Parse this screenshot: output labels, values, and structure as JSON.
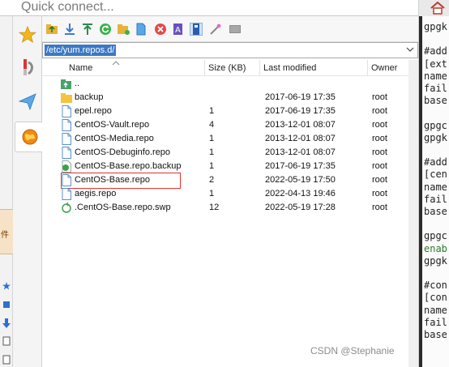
{
  "quick_connect": {
    "placeholder": "Quick connect..."
  },
  "left_strip": {
    "label": "件"
  },
  "path": {
    "value": "/etc/yum.repos.d/"
  },
  "columns": {
    "name": "Name",
    "size": "Size (KB)",
    "modified": "Last modified",
    "owner": "Owner"
  },
  "files": [
    {
      "icon": "parent-folder-icon",
      "name": "..",
      "size": "",
      "date": "",
      "owner": ""
    },
    {
      "icon": "folder-icon",
      "name": "backup",
      "size": "",
      "date": "2017-06-19 17:35",
      "owner": "root"
    },
    {
      "icon": "file-icon",
      "name": "epel.repo",
      "size": "1",
      "date": "2017-06-19 17:35",
      "owner": "root"
    },
    {
      "icon": "file-icon",
      "name": "CentOS-Vault.repo",
      "size": "4",
      "date": "2013-12-01 08:07",
      "owner": "root"
    },
    {
      "icon": "file-icon",
      "name": "CentOS-Media.repo",
      "size": "1",
      "date": "2013-12-01 08:07",
      "owner": "root"
    },
    {
      "icon": "file-icon",
      "name": "CentOS-Debuginfo.repo",
      "size": "1",
      "date": "2013-12-01 08:07",
      "owner": "root"
    },
    {
      "icon": "recycle-file-icon",
      "name": "CentOS-Base.repo.backup",
      "size": "1",
      "date": "2017-06-19 17:35",
      "owner": "root"
    },
    {
      "icon": "file-icon",
      "name": "CentOS-Base.repo",
      "size": "2",
      "date": "2022-05-19 17:50",
      "owner": "root"
    },
    {
      "icon": "file-icon",
      "name": "aegis.repo",
      "size": "1",
      "date": "2022-04-13 19:46",
      "owner": "root"
    },
    {
      "icon": "swap-file-icon",
      "name": ".CentOS-Base.repo.swp",
      "size": "12",
      "date": "2022-05-19 17:28",
      "owner": "root"
    }
  ],
  "terminal_lines": [
    {
      "text": "gpgk",
      "color": "#222222"
    },
    {
      "text": "",
      "color": "#222222"
    },
    {
      "text": "#add",
      "color": "#222222"
    },
    {
      "text": "[ext",
      "color": "#222222"
    },
    {
      "text": "name",
      "color": "#222222"
    },
    {
      "text": "fail",
      "color": "#222222"
    },
    {
      "text": "base",
      "color": "#222222"
    },
    {
      "text": "",
      "color": "#222222"
    },
    {
      "text": "gpgc",
      "color": "#222222"
    },
    {
      "text": "gpgk",
      "color": "#222222"
    },
    {
      "text": "",
      "color": "#222222"
    },
    {
      "text": "#add",
      "color": "#222222"
    },
    {
      "text": "[cen",
      "color": "#222222"
    },
    {
      "text": "name",
      "color": "#222222"
    },
    {
      "text": "fail",
      "color": "#222222"
    },
    {
      "text": "base",
      "color": "#222222"
    },
    {
      "text": "",
      "color": "#222222"
    },
    {
      "text": "gpgc",
      "color": "#222222"
    },
    {
      "text": "enab",
      "color": "#2b7a2b"
    },
    {
      "text": "gpgk",
      "color": "#222222"
    },
    {
      "text": "",
      "color": "#222222"
    },
    {
      "text": "#con",
      "color": "#222222"
    },
    {
      "text": "[con",
      "color": "#222222"
    },
    {
      "text": "name",
      "color": "#222222"
    },
    {
      "text": "fail",
      "color": "#222222"
    },
    {
      "text": "base",
      "color": "#222222"
    }
  ],
  "watermark": "CSDN @Stephanie"
}
